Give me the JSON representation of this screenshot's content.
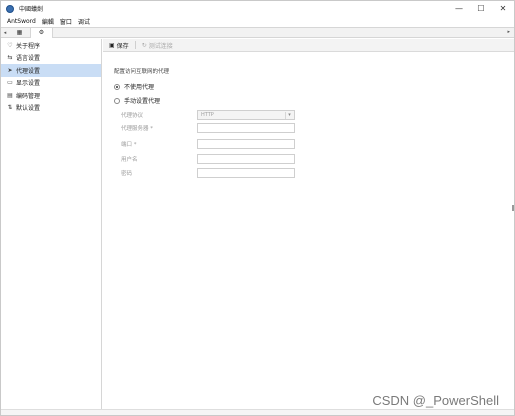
{
  "window": {
    "title": "中國蟻劍",
    "controls": {
      "minimize": "—",
      "maximize": "☐",
      "close": "✕"
    }
  },
  "menubar": {
    "items": [
      "AntSword",
      "編輯",
      "窗口",
      "调试"
    ]
  },
  "tabs": {
    "left_arrow": "◂",
    "right_arrow": "▸",
    "home_icon": "▦",
    "settings_icon": "⚙"
  },
  "sidebar": {
    "items": [
      {
        "label": "关于程序",
        "icon": "♡"
      },
      {
        "label": "语言设置",
        "icon": "⇆"
      },
      {
        "label": "代理设置",
        "icon": "➤"
      },
      {
        "label": "显示设置",
        "icon": "▭"
      },
      {
        "label": "编码管理",
        "icon": "▤"
      },
      {
        "label": "默认设置",
        "icon": "⇅"
      }
    ],
    "active_index": 2
  },
  "toolbar": {
    "save_label": "保存",
    "save_icon": "▣",
    "test_label": "测试连接",
    "test_icon": "↻"
  },
  "proxy": {
    "description": "配置访问互联网的代理",
    "no_proxy_label": "不使用代理",
    "manual_proxy_label": "手动设置代理",
    "selected": "no_proxy",
    "fields": {
      "protocol_label": "代理协议",
      "protocol_value": "HTTP",
      "server_label": "代理服务器 *",
      "port_label": "端口 *",
      "username_label": "用户名",
      "password_label": "密码"
    }
  },
  "watermark": "CSDN @_PowerShell"
}
